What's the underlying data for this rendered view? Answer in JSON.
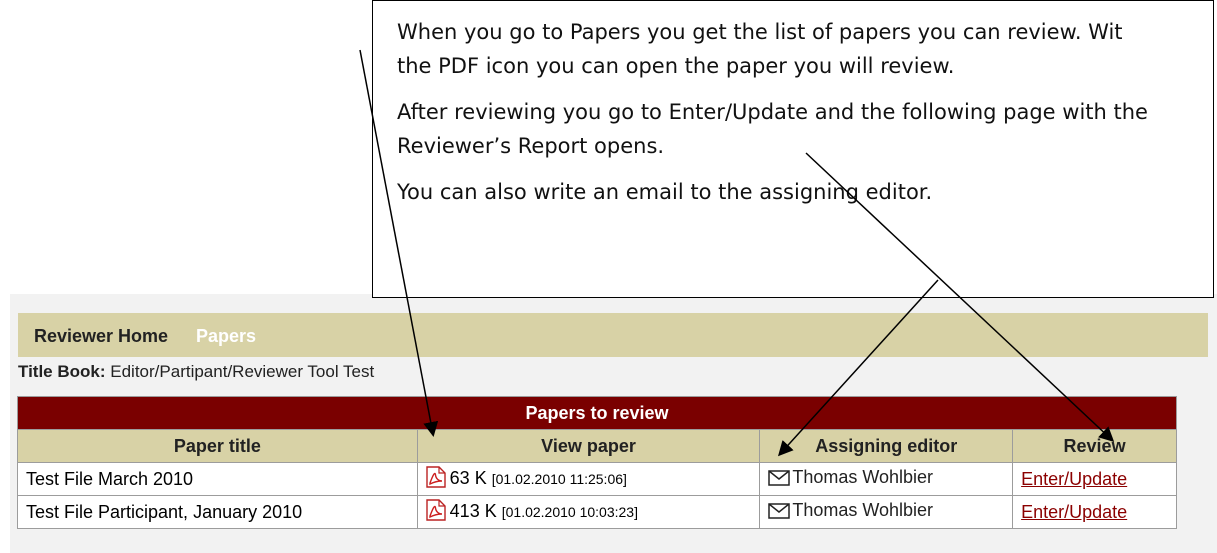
{
  "nav": {
    "items": [
      {
        "label": "Reviewer Home"
      },
      {
        "label": "Papers"
      }
    ]
  },
  "book": {
    "label": "Title Book:",
    "value": "Editor/Partipant/Reviewer Tool Test"
  },
  "table": {
    "caption": "Papers to review",
    "columns": [
      "Paper title",
      "View paper",
      "Assigning editor",
      "Review"
    ],
    "rows": [
      {
        "title": "Test File March 2010",
        "size": "63 K",
        "date": "[01.02.2010 11:25:06]",
        "editor": "Thomas Wohlbier",
        "review": "Enter/Update"
      },
      {
        "title": "Test File Participant, January 2010",
        "size": "413 K",
        "date": "[01.02.2010 10:03:23]",
        "editor": "Thomas Wohlbier",
        "review": "Enter/Update"
      }
    ]
  },
  "callout": {
    "line1": "When you go to Papers you get the list of papers you can review. Wit",
    "line2": "the PDF icon you can open the paper you will review.",
    "para2": "After reviewing you go to Enter/Update and the following page with the Reviewer’s Report opens.",
    "para3": "You can also write an email to the assigning editor."
  },
  "colors": {
    "nav_bg": "#d8d2a6",
    "caption_bg": "#7a0000",
    "link": "#8b0000",
    "pdf_red": "#cc1e1e"
  },
  "icons": [
    "pdf-icon",
    "mail-icon"
  ]
}
